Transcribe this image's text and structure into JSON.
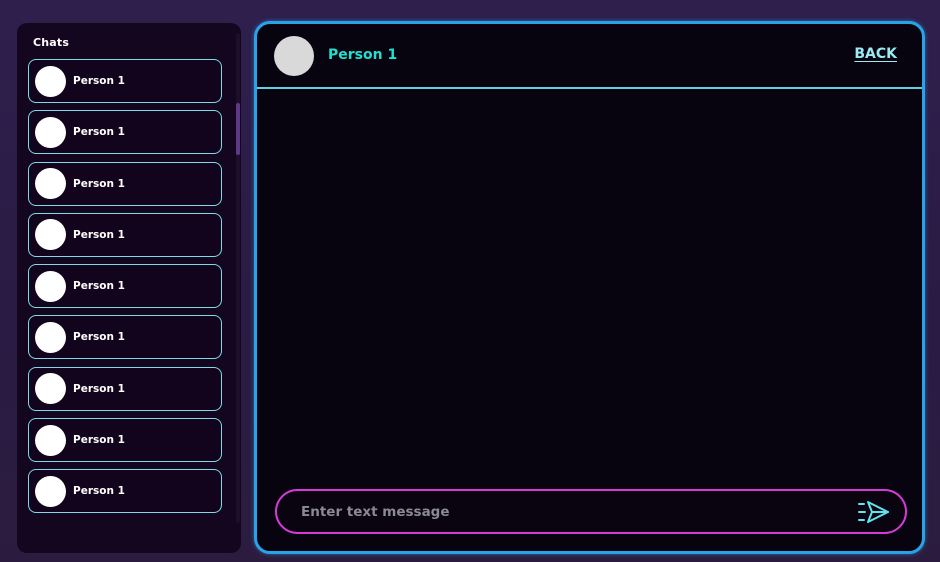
{
  "sidebar": {
    "title": "Chats",
    "chats": [
      {
        "name": "Person 1"
      },
      {
        "name": "Person 1"
      },
      {
        "name": "Person 1"
      },
      {
        "name": "Person 1"
      },
      {
        "name": "Person 1"
      },
      {
        "name": "Person 1"
      },
      {
        "name": "Person 1"
      },
      {
        "name": "Person 1"
      },
      {
        "name": "Person 1"
      }
    ]
  },
  "chat": {
    "contact_name": "Person 1",
    "back_label": "BACK",
    "composer": {
      "placeholder": "Enter text message",
      "value": "",
      "send_icon": "send-icon"
    }
  },
  "colors": {
    "accent_cyan": "#20e0d2",
    "window_border": "#29a3e8",
    "composer_border": "#d63ad6",
    "item_border": "#7fd9e8"
  }
}
